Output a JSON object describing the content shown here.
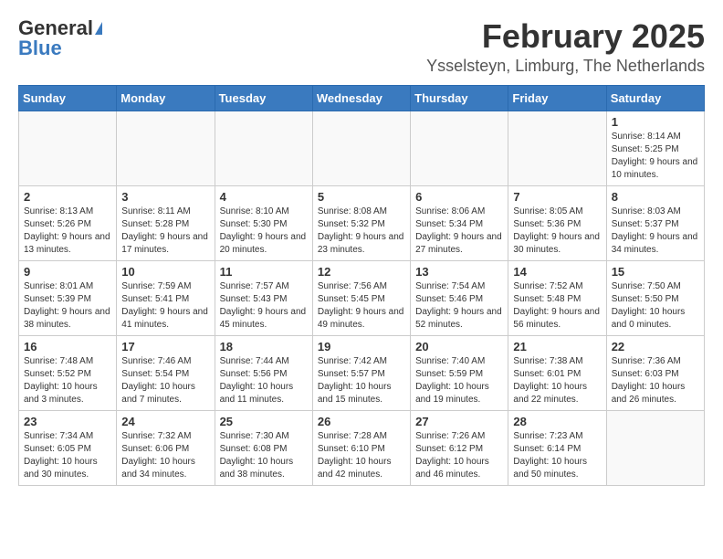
{
  "header": {
    "logo_general": "General",
    "logo_blue": "Blue",
    "title": "February 2025",
    "subtitle": "Ysselsteyn, Limburg, The Netherlands"
  },
  "days_of_week": [
    "Sunday",
    "Monday",
    "Tuesday",
    "Wednesday",
    "Thursday",
    "Friday",
    "Saturday"
  ],
  "weeks": [
    [
      {
        "day": "",
        "info": ""
      },
      {
        "day": "",
        "info": ""
      },
      {
        "day": "",
        "info": ""
      },
      {
        "day": "",
        "info": ""
      },
      {
        "day": "",
        "info": ""
      },
      {
        "day": "",
        "info": ""
      },
      {
        "day": "1",
        "info": "Sunrise: 8:14 AM\nSunset: 5:25 PM\nDaylight: 9 hours\nand 10 minutes."
      }
    ],
    [
      {
        "day": "2",
        "info": "Sunrise: 8:13 AM\nSunset: 5:26 PM\nDaylight: 9 hours\nand 13 minutes."
      },
      {
        "day": "3",
        "info": "Sunrise: 8:11 AM\nSunset: 5:28 PM\nDaylight: 9 hours\nand 17 minutes."
      },
      {
        "day": "4",
        "info": "Sunrise: 8:10 AM\nSunset: 5:30 PM\nDaylight: 9 hours\nand 20 minutes."
      },
      {
        "day": "5",
        "info": "Sunrise: 8:08 AM\nSunset: 5:32 PM\nDaylight: 9 hours\nand 23 minutes."
      },
      {
        "day": "6",
        "info": "Sunrise: 8:06 AM\nSunset: 5:34 PM\nDaylight: 9 hours\nand 27 minutes."
      },
      {
        "day": "7",
        "info": "Sunrise: 8:05 AM\nSunset: 5:36 PM\nDaylight: 9 hours\nand 30 minutes."
      },
      {
        "day": "8",
        "info": "Sunrise: 8:03 AM\nSunset: 5:37 PM\nDaylight: 9 hours\nand 34 minutes."
      }
    ],
    [
      {
        "day": "9",
        "info": "Sunrise: 8:01 AM\nSunset: 5:39 PM\nDaylight: 9 hours\nand 38 minutes."
      },
      {
        "day": "10",
        "info": "Sunrise: 7:59 AM\nSunset: 5:41 PM\nDaylight: 9 hours\nand 41 minutes."
      },
      {
        "day": "11",
        "info": "Sunrise: 7:57 AM\nSunset: 5:43 PM\nDaylight: 9 hours\nand 45 minutes."
      },
      {
        "day": "12",
        "info": "Sunrise: 7:56 AM\nSunset: 5:45 PM\nDaylight: 9 hours\nand 49 minutes."
      },
      {
        "day": "13",
        "info": "Sunrise: 7:54 AM\nSunset: 5:46 PM\nDaylight: 9 hours\nand 52 minutes."
      },
      {
        "day": "14",
        "info": "Sunrise: 7:52 AM\nSunset: 5:48 PM\nDaylight: 9 hours\nand 56 minutes."
      },
      {
        "day": "15",
        "info": "Sunrise: 7:50 AM\nSunset: 5:50 PM\nDaylight: 10 hours\nand 0 minutes."
      }
    ],
    [
      {
        "day": "16",
        "info": "Sunrise: 7:48 AM\nSunset: 5:52 PM\nDaylight: 10 hours\nand 3 minutes."
      },
      {
        "day": "17",
        "info": "Sunrise: 7:46 AM\nSunset: 5:54 PM\nDaylight: 10 hours\nand 7 minutes."
      },
      {
        "day": "18",
        "info": "Sunrise: 7:44 AM\nSunset: 5:56 PM\nDaylight: 10 hours\nand 11 minutes."
      },
      {
        "day": "19",
        "info": "Sunrise: 7:42 AM\nSunset: 5:57 PM\nDaylight: 10 hours\nand 15 minutes."
      },
      {
        "day": "20",
        "info": "Sunrise: 7:40 AM\nSunset: 5:59 PM\nDaylight: 10 hours\nand 19 minutes."
      },
      {
        "day": "21",
        "info": "Sunrise: 7:38 AM\nSunset: 6:01 PM\nDaylight: 10 hours\nand 22 minutes."
      },
      {
        "day": "22",
        "info": "Sunrise: 7:36 AM\nSunset: 6:03 PM\nDaylight: 10 hours\nand 26 minutes."
      }
    ],
    [
      {
        "day": "23",
        "info": "Sunrise: 7:34 AM\nSunset: 6:05 PM\nDaylight: 10 hours\nand 30 minutes."
      },
      {
        "day": "24",
        "info": "Sunrise: 7:32 AM\nSunset: 6:06 PM\nDaylight: 10 hours\nand 34 minutes."
      },
      {
        "day": "25",
        "info": "Sunrise: 7:30 AM\nSunset: 6:08 PM\nDaylight: 10 hours\nand 38 minutes."
      },
      {
        "day": "26",
        "info": "Sunrise: 7:28 AM\nSunset: 6:10 PM\nDaylight: 10 hours\nand 42 minutes."
      },
      {
        "day": "27",
        "info": "Sunrise: 7:26 AM\nSunset: 6:12 PM\nDaylight: 10 hours\nand 46 minutes."
      },
      {
        "day": "28",
        "info": "Sunrise: 7:23 AM\nSunset: 6:14 PM\nDaylight: 10 hours\nand 50 minutes."
      },
      {
        "day": "",
        "info": ""
      }
    ]
  ]
}
